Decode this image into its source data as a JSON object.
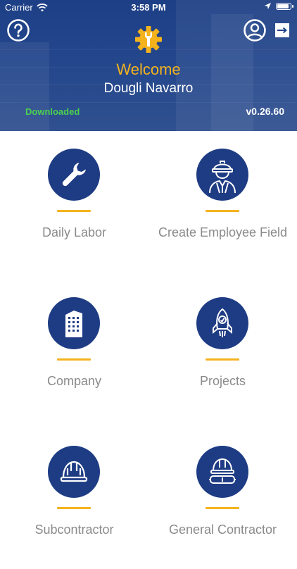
{
  "status_bar": {
    "carrier": "Carrier",
    "time": "3:58 PM",
    "battery_level": 0.95
  },
  "header": {
    "welcome": "Welcome",
    "user_name": "Dougli Navarro",
    "sync_status": "Downloaded",
    "version": "v0.26.60"
  },
  "colors": {
    "header_blue": "#23468c",
    "accent_yellow": "#f4b21c",
    "icon_circle": "#1e3c84",
    "label_gray": "#8a8a8a",
    "downloaded_green": "#4bd14f"
  },
  "menu": {
    "items": [
      {
        "label": "Daily Labor",
        "icon": "wrench-icon"
      },
      {
        "label": "Create Employee Field",
        "icon": "worker-icon"
      },
      {
        "label": "Company",
        "icon": "building-icon"
      },
      {
        "label": "Projects",
        "icon": "rocket-icon"
      },
      {
        "label": "Subcontractor",
        "icon": "hard-hat-icon"
      },
      {
        "label": "General Contractor",
        "icon": "hard-hat-goggles-icon"
      }
    ]
  }
}
